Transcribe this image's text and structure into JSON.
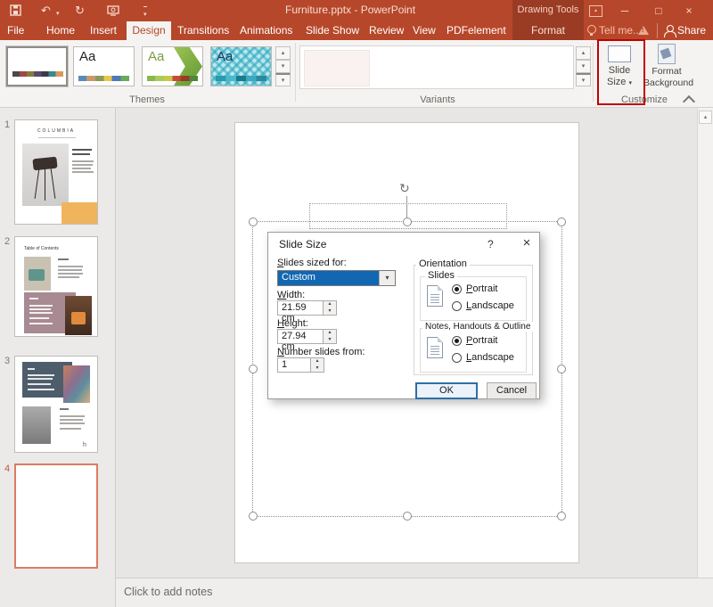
{
  "window": {
    "title": "Furniture.pptx - PowerPoint",
    "context_label": "Drawing Tools"
  },
  "menubar": {
    "file": "File",
    "tabs": [
      "Home",
      "Insert",
      "Design",
      "Transitions",
      "Animations",
      "Slide Show",
      "Review",
      "View",
      "PDFelement"
    ],
    "active_tab": "Design",
    "context_tab": "Format",
    "tell_me": "Tell me...",
    "share": "Share"
  },
  "ribbon": {
    "theme_sample": "Aa",
    "themes_label": "Themes",
    "variants_label": "Variants",
    "customize_label": "Customize",
    "slide_size": {
      "line1": "Slide",
      "line2": "Size"
    },
    "format_background": {
      "line1": "Format",
      "line2": "Background"
    }
  },
  "slides": {
    "s1_number": "1",
    "s1_title": "COLUMBIA",
    "s2_number": "2",
    "s2_title": "Table of Contents",
    "s3_number": "3",
    "s3_mark": "h",
    "s4_number": "4"
  },
  "dialog": {
    "title": "Slide Size",
    "help_icon": "?",
    "close_icon": "×",
    "sized_for_label": "Slides sized for:",
    "sized_for_value": "Custom",
    "width_label": "Width:",
    "width_value": "21.59 cm",
    "height_label": "Height:",
    "height_value": "27.94 cm",
    "number_label": "Number slides from:",
    "number_value": "1",
    "orientation_label": "Orientation",
    "slides_group_label": "Slides",
    "notes_group_label": "Notes, Handouts & Outline",
    "portrait_label": "Portrait",
    "landscape_label": "Landscape",
    "ok_label": "OK",
    "cancel_label": "Cancel"
  },
  "notes": {
    "placeholder": "Click to add notes"
  },
  "icons": {
    "minimize": "─",
    "maximize": "□",
    "close": "×",
    "dropdown": "▾",
    "spin_up": "▴",
    "spin_down": "▾",
    "undo": "↶",
    "redo": "↻",
    "rotate": "↻",
    "scroll_up": "▴",
    "scroll_down": "▾"
  },
  "colors": {
    "titlebar_red": "#B7472A",
    "context_red": "#9A3B24",
    "annotation_red": "#C00000",
    "selection_blue": "#1167B1",
    "thumb_selected": "#DE7B60"
  }
}
